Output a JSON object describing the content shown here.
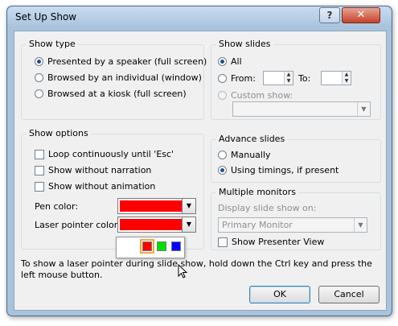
{
  "window": {
    "title": "Set Up Show",
    "help_glyph": "?",
    "close_glyph": "✕"
  },
  "show_type": {
    "title": "Show type",
    "options": [
      {
        "label": "Presented by a speaker (full screen)",
        "selected": true
      },
      {
        "label": "Browsed by an individual (window)",
        "selected": false
      },
      {
        "label": "Browsed at a kiosk (full screen)",
        "selected": false
      }
    ]
  },
  "show_slides": {
    "title": "Show slides",
    "all_label": "All",
    "from_label": "From:",
    "to_label": "To:",
    "from_value": "",
    "to_value": "",
    "custom_label": "Custom show:",
    "custom_value": ""
  },
  "show_options": {
    "title": "Show options",
    "checks": [
      {
        "label": "Loop continuously until 'Esc'",
        "checked": false
      },
      {
        "label": "Show without narration",
        "checked": false
      },
      {
        "label": "Show without animation",
        "checked": false
      }
    ],
    "pen_color_label": "Pen color:",
    "pen_color": "#ff0000",
    "laser_color_label": "Laser pointer color:",
    "laser_color": "#ff0000",
    "laser_options": [
      "#ff0000",
      "#00e000",
      "#0000ff"
    ]
  },
  "advance_slides": {
    "title": "Advance slides",
    "options": [
      {
        "label": "Manually",
        "selected": false
      },
      {
        "label": "Using timings, if present",
        "selected": true
      }
    ]
  },
  "multiple_monitors": {
    "title": "Multiple monitors",
    "display_label": "Display slide show on:",
    "display_value": "Primary Monitor",
    "presenter_label": "Show Presenter View",
    "presenter_checked": false
  },
  "hint_text": "To show a laser pointer during slide show, hold down the Ctrl key and press the left mouse button.",
  "buttons": {
    "ok": "OK",
    "cancel": "Cancel"
  }
}
